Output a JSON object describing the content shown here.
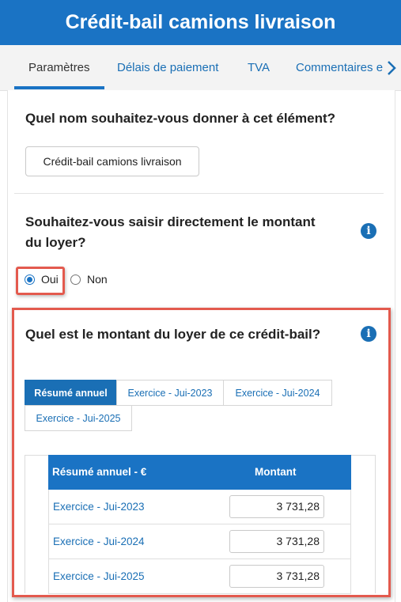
{
  "header": {
    "title": "Crédit-bail camions livraison"
  },
  "tabs": [
    {
      "label": "Paramètres"
    },
    {
      "label": "Délais de paiement"
    },
    {
      "label": "TVA"
    },
    {
      "label": "Commentaires e"
    }
  ],
  "name_question": {
    "text": "Quel nom souhaitez-vous donner à cet élément?",
    "value": "Crédit-bail camions livraison"
  },
  "rent_direct_question": {
    "line1": "Souhaitez-vous saisir directement le montant",
    "line2": "du loyer?",
    "options": [
      {
        "label": "Oui",
        "checked": true
      },
      {
        "label": "Non",
        "checked": false
      }
    ]
  },
  "rent_amount": {
    "question": "Quel est le montant du loyer de ce crédit-bail?",
    "year_tabs": [
      {
        "label": "Résumé annuel",
        "active": true
      },
      {
        "label": "Exercice - Jui-2023"
      },
      {
        "label": "Exercice - Jui-2024"
      },
      {
        "label": "Exercice - Jui-2025"
      }
    ],
    "table": {
      "col1": "Résumé annuel - €",
      "col2": "Montant",
      "rows": [
        {
          "label": "Exercice - Jui-2023",
          "value": "3 731,28"
        },
        {
          "label": "Exercice - Jui-2024",
          "value": "3 731,28"
        },
        {
          "label": "Exercice - Jui-2025",
          "value": "3 731,28"
        }
      ]
    }
  },
  "icons": {
    "info": "info-icon",
    "chevron": "chevron-right-icon"
  },
  "colors": {
    "primary": "#1a73c4",
    "highlight": "#e35a4e"
  }
}
